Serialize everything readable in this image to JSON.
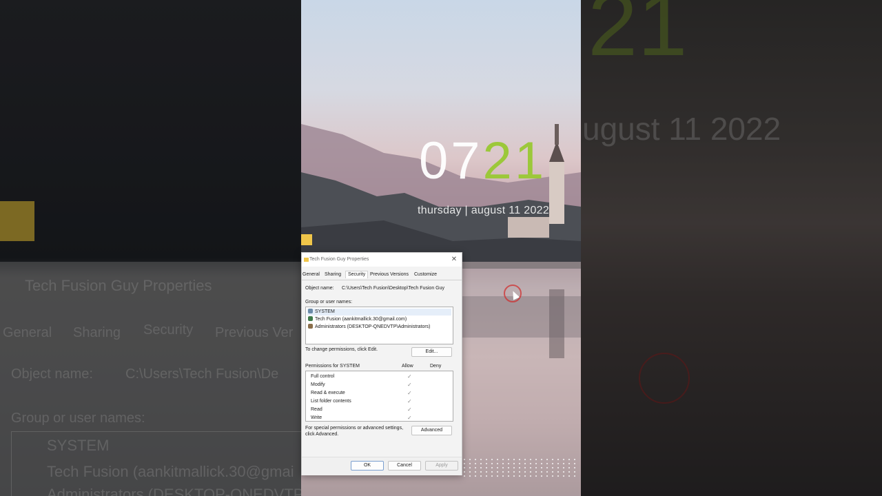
{
  "dialog": {
    "title": "Tech Fusion Guy Properties",
    "close_glyph": "✕",
    "tabs": [
      {
        "label": "General"
      },
      {
        "label": "Sharing"
      },
      {
        "label": "Security"
      },
      {
        "label": "Previous Versions"
      },
      {
        "label": "Customize"
      }
    ],
    "active_tab": "Security",
    "object_name_label": "Object name:",
    "object_name_value": "C:\\Users\\Tech Fusion\\Desktop\\Tech Fusion Guy",
    "group_label": "Group or user names:",
    "users": [
      {
        "name": "SYSTEM",
        "icon": "users-icon"
      },
      {
        "name": "Tech Fusion (aankitmallick.30@gmail.com)",
        "icon": "user-icon"
      },
      {
        "name": "Administrators (DESKTOP-QNEDVTP\\Administrators)",
        "icon": "users-icon"
      }
    ],
    "change_hint": "To change permissions, click Edit.",
    "edit_label": "Edit...",
    "permissions_for": "Permissions for SYSTEM",
    "allow_label": "Allow",
    "deny_label": "Deny",
    "permissions": [
      {
        "name": "Full control",
        "allow": "✓"
      },
      {
        "name": "Modify",
        "allow": "✓"
      },
      {
        "name": "Read & execute",
        "allow": "✓"
      },
      {
        "name": "List folder contents",
        "allow": "✓"
      },
      {
        "name": "Read",
        "allow": "✓"
      },
      {
        "name": "Write",
        "allow": "✓"
      }
    ],
    "special_hint_line1": "For special permissions or advanced settings,",
    "special_hint_line2": "click Advanced.",
    "advanced_label": "Advanced",
    "ok_label": "OK",
    "cancel_label": "Cancel",
    "apply_label": "Apply"
  },
  "wallpaper": {
    "clock_hours": "07",
    "clock_minutes": "21",
    "date": "thursday | august 11 2022",
    "accent_color": "#9cc83a"
  },
  "background_ghost": {
    "title": "Tech Fusion Guy Properties",
    "tabs": [
      "General",
      "Sharing",
      "Security",
      "Previous Ver"
    ],
    "object_name_label": "Object name:",
    "object_name_value": "C:\\Users\\Tech Fusion\\De",
    "group_label": "Group or user names:",
    "users": [
      "SYSTEM",
      "Tech Fusion (aankitmallick.30@gmai",
      "Administrators (DESKTOP-QNEDVTP"
    ],
    "date_fragment": "ugust 11 2022",
    "clock_fragment": "21"
  }
}
